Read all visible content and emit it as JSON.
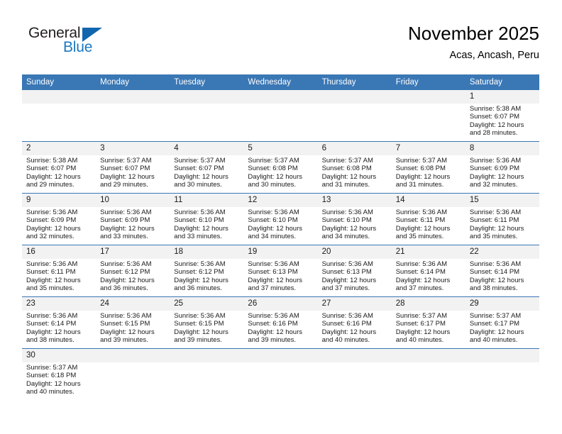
{
  "brand": {
    "name_top": "General",
    "name_bottom": "Blue",
    "triangle_color": "#1166ad",
    "blue_color": "#1b78c2"
  },
  "header": {
    "title": "November 2025",
    "subtitle": "Acas, Ancash, Peru"
  },
  "theme": {
    "header_blue": "#3a77b5",
    "daynum_bg": "#f2f2f2",
    "row_divider": "#3a77b5"
  },
  "weekday_headers": [
    "Sunday",
    "Monday",
    "Tuesday",
    "Wednesday",
    "Thursday",
    "Friday",
    "Saturday"
  ],
  "weeks": [
    [
      {
        "day": "",
        "lines": []
      },
      {
        "day": "",
        "lines": []
      },
      {
        "day": "",
        "lines": []
      },
      {
        "day": "",
        "lines": []
      },
      {
        "day": "",
        "lines": []
      },
      {
        "day": "",
        "lines": []
      },
      {
        "day": "1",
        "lines": [
          "Sunrise: 5:38 AM",
          "Sunset: 6:07 PM",
          "Daylight: 12 hours",
          "and 28 minutes."
        ]
      }
    ],
    [
      {
        "day": "2",
        "lines": [
          "Sunrise: 5:38 AM",
          "Sunset: 6:07 PM",
          "Daylight: 12 hours",
          "and 29 minutes."
        ]
      },
      {
        "day": "3",
        "lines": [
          "Sunrise: 5:37 AM",
          "Sunset: 6:07 PM",
          "Daylight: 12 hours",
          "and 29 minutes."
        ]
      },
      {
        "day": "4",
        "lines": [
          "Sunrise: 5:37 AM",
          "Sunset: 6:07 PM",
          "Daylight: 12 hours",
          "and 30 minutes."
        ]
      },
      {
        "day": "5",
        "lines": [
          "Sunrise: 5:37 AM",
          "Sunset: 6:08 PM",
          "Daylight: 12 hours",
          "and 30 minutes."
        ]
      },
      {
        "day": "6",
        "lines": [
          "Sunrise: 5:37 AM",
          "Sunset: 6:08 PM",
          "Daylight: 12 hours",
          "and 31 minutes."
        ]
      },
      {
        "day": "7",
        "lines": [
          "Sunrise: 5:37 AM",
          "Sunset: 6:08 PM",
          "Daylight: 12 hours",
          "and 31 minutes."
        ]
      },
      {
        "day": "8",
        "lines": [
          "Sunrise: 5:36 AM",
          "Sunset: 6:09 PM",
          "Daylight: 12 hours",
          "and 32 minutes."
        ]
      }
    ],
    [
      {
        "day": "9",
        "lines": [
          "Sunrise: 5:36 AM",
          "Sunset: 6:09 PM",
          "Daylight: 12 hours",
          "and 32 minutes."
        ]
      },
      {
        "day": "10",
        "lines": [
          "Sunrise: 5:36 AM",
          "Sunset: 6:09 PM",
          "Daylight: 12 hours",
          "and 33 minutes."
        ]
      },
      {
        "day": "11",
        "lines": [
          "Sunrise: 5:36 AM",
          "Sunset: 6:10 PM",
          "Daylight: 12 hours",
          "and 33 minutes."
        ]
      },
      {
        "day": "12",
        "lines": [
          "Sunrise: 5:36 AM",
          "Sunset: 6:10 PM",
          "Daylight: 12 hours",
          "and 34 minutes."
        ]
      },
      {
        "day": "13",
        "lines": [
          "Sunrise: 5:36 AM",
          "Sunset: 6:10 PM",
          "Daylight: 12 hours",
          "and 34 minutes."
        ]
      },
      {
        "day": "14",
        "lines": [
          "Sunrise: 5:36 AM",
          "Sunset: 6:11 PM",
          "Daylight: 12 hours",
          "and 35 minutes."
        ]
      },
      {
        "day": "15",
        "lines": [
          "Sunrise: 5:36 AM",
          "Sunset: 6:11 PM",
          "Daylight: 12 hours",
          "and 35 minutes."
        ]
      }
    ],
    [
      {
        "day": "16",
        "lines": [
          "Sunrise: 5:36 AM",
          "Sunset: 6:11 PM",
          "Daylight: 12 hours",
          "and 35 minutes."
        ]
      },
      {
        "day": "17",
        "lines": [
          "Sunrise: 5:36 AM",
          "Sunset: 6:12 PM",
          "Daylight: 12 hours",
          "and 36 minutes."
        ]
      },
      {
        "day": "18",
        "lines": [
          "Sunrise: 5:36 AM",
          "Sunset: 6:12 PM",
          "Daylight: 12 hours",
          "and 36 minutes."
        ]
      },
      {
        "day": "19",
        "lines": [
          "Sunrise: 5:36 AM",
          "Sunset: 6:13 PM",
          "Daylight: 12 hours",
          "and 37 minutes."
        ]
      },
      {
        "day": "20",
        "lines": [
          "Sunrise: 5:36 AM",
          "Sunset: 6:13 PM",
          "Daylight: 12 hours",
          "and 37 minutes."
        ]
      },
      {
        "day": "21",
        "lines": [
          "Sunrise: 5:36 AM",
          "Sunset: 6:14 PM",
          "Daylight: 12 hours",
          "and 37 minutes."
        ]
      },
      {
        "day": "22",
        "lines": [
          "Sunrise: 5:36 AM",
          "Sunset: 6:14 PM",
          "Daylight: 12 hours",
          "and 38 minutes."
        ]
      }
    ],
    [
      {
        "day": "23",
        "lines": [
          "Sunrise: 5:36 AM",
          "Sunset: 6:14 PM",
          "Daylight: 12 hours",
          "and 38 minutes."
        ]
      },
      {
        "day": "24",
        "lines": [
          "Sunrise: 5:36 AM",
          "Sunset: 6:15 PM",
          "Daylight: 12 hours",
          "and 39 minutes."
        ]
      },
      {
        "day": "25",
        "lines": [
          "Sunrise: 5:36 AM",
          "Sunset: 6:15 PM",
          "Daylight: 12 hours",
          "and 39 minutes."
        ]
      },
      {
        "day": "26",
        "lines": [
          "Sunrise: 5:36 AM",
          "Sunset: 6:16 PM",
          "Daylight: 12 hours",
          "and 39 minutes."
        ]
      },
      {
        "day": "27",
        "lines": [
          "Sunrise: 5:36 AM",
          "Sunset: 6:16 PM",
          "Daylight: 12 hours",
          "and 40 minutes."
        ]
      },
      {
        "day": "28",
        "lines": [
          "Sunrise: 5:37 AM",
          "Sunset: 6:17 PM",
          "Daylight: 12 hours",
          "and 40 minutes."
        ]
      },
      {
        "day": "29",
        "lines": [
          "Sunrise: 5:37 AM",
          "Sunset: 6:17 PM",
          "Daylight: 12 hours",
          "and 40 minutes."
        ]
      }
    ],
    [
      {
        "day": "30",
        "lines": [
          "Sunrise: 5:37 AM",
          "Sunset: 6:18 PM",
          "Daylight: 12 hours",
          "and 40 minutes."
        ]
      },
      {
        "day": "",
        "lines": []
      },
      {
        "day": "",
        "lines": []
      },
      {
        "day": "",
        "lines": []
      },
      {
        "day": "",
        "lines": []
      },
      {
        "day": "",
        "lines": []
      },
      {
        "day": "",
        "lines": []
      }
    ]
  ]
}
